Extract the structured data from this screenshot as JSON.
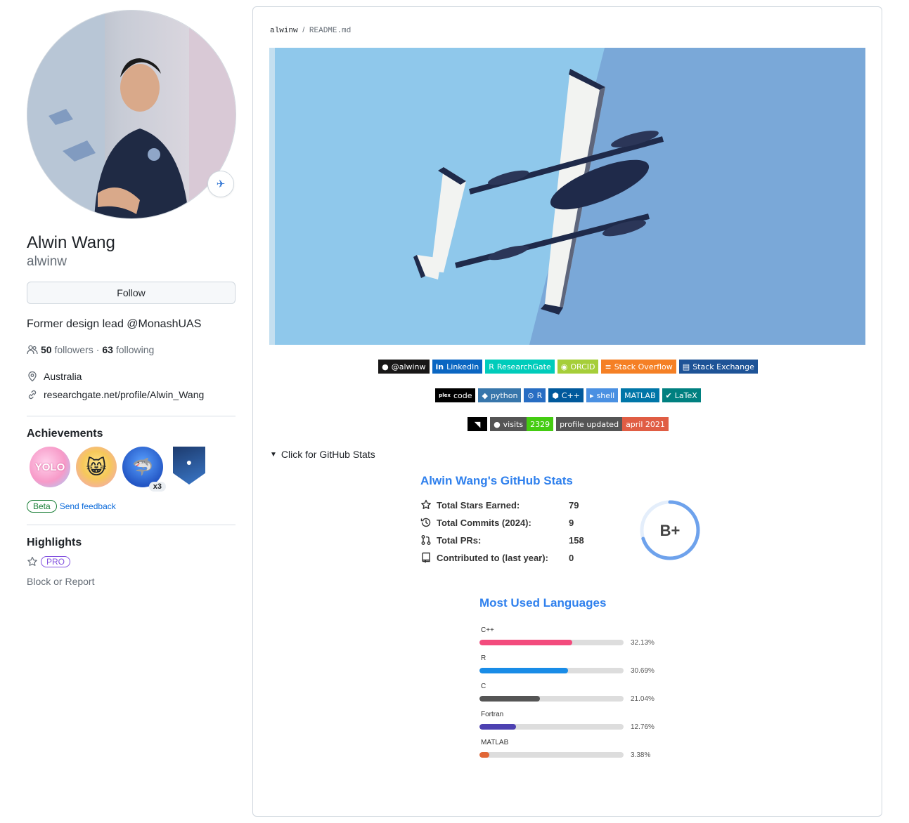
{
  "profile": {
    "fullname": "Alwin Wang",
    "username": "alwinw",
    "follow_label": "Follow",
    "bio_prefix": "Former design lead ",
    "bio_mention": "@MonashUAS",
    "followers_count": "50",
    "followers_label": "followers",
    "following_sep": "·",
    "following_count": "63",
    "following_label": "following",
    "location": "Australia",
    "website": "researchgate.net/profile/Alwin_Wang",
    "status_icon": "airplane-icon"
  },
  "achievements": {
    "title": "Achievements",
    "items": [
      {
        "name": "YOLO",
        "label": "YOLO"
      },
      {
        "name": "quickdraw",
        "label": ""
      },
      {
        "name": "pull-shark",
        "label": "",
        "count": "x3"
      },
      {
        "name": "arctic-code-vault",
        "label": ""
      }
    ],
    "beta_label": "Beta",
    "feedback_label": "Send feedback"
  },
  "highlights": {
    "title": "Highlights",
    "pro_label": "PRO",
    "block_label": "Block or Report"
  },
  "readme": {
    "owner": "alwinw",
    "separator": "/",
    "file": "README.md",
    "details_label": "Click for GitHub Stats"
  },
  "badges": {
    "row1": [
      {
        "label": "@alwinw",
        "bg": "#181717"
      },
      {
        "label": "LinkedIn",
        "bg": "#0a66c2"
      },
      {
        "label": "ResearchGate",
        "bg": "#00ccbb"
      },
      {
        "label": "ORCID",
        "bg": "#a6ce39"
      },
      {
        "label": "Stack Overflow",
        "bg": "#f58025"
      },
      {
        "label": "Stack Exchange",
        "bg": "#1e5397"
      }
    ],
    "row2": [
      {
        "label": "code",
        "bg": "#000000",
        "prefix": "plex"
      },
      {
        "label": "python",
        "bg": "#3776ab"
      },
      {
        "label": "R",
        "bg": "#276dc3"
      },
      {
        "label": "C++",
        "bg": "#00599c"
      },
      {
        "label": "shell",
        "bg": "#4eaa25"
      },
      {
        "label": "MATLAB",
        "bg": "#0076a8"
      },
      {
        "label": "LaTeX",
        "bg": "#008080"
      }
    ],
    "row3": {
      "visits_label": "visits",
      "visits_count": "2329",
      "updated_label": "profile updated",
      "updated_value": "april 2021"
    }
  },
  "stats": {
    "title": "Alwin Wang's GitHub Stats",
    "rows": [
      {
        "label": "Total Stars Earned:",
        "value": "79",
        "icon": "star-icon"
      },
      {
        "label": "Total Commits (2024):",
        "value": "9",
        "icon": "history-icon"
      },
      {
        "label": "Total PRs:",
        "value": "158",
        "icon": "pull-request-icon"
      },
      {
        "label": "Contributed to (last year):",
        "value": "0",
        "icon": "repo-icon"
      }
    ],
    "grade": "B+",
    "grade_progress": 0.7
  },
  "languages": {
    "title": "Most Used Languages",
    "items": [
      {
        "name": "C++",
        "percent": 32.13,
        "percent_label": "32.13%",
        "color": "#f34b7d"
      },
      {
        "name": "R",
        "percent": 30.69,
        "percent_label": "30.69%",
        "color": "#198ce7"
      },
      {
        "name": "C",
        "percent": 21.04,
        "percent_label": "21.04%",
        "color": "#555555"
      },
      {
        "name": "Fortran",
        "percent": 12.76,
        "percent_label": "12.76%",
        "color": "#4d41b1"
      },
      {
        "name": "MATLAB",
        "percent": 3.38,
        "percent_label": "3.38%",
        "color": "#e16737"
      }
    ]
  }
}
